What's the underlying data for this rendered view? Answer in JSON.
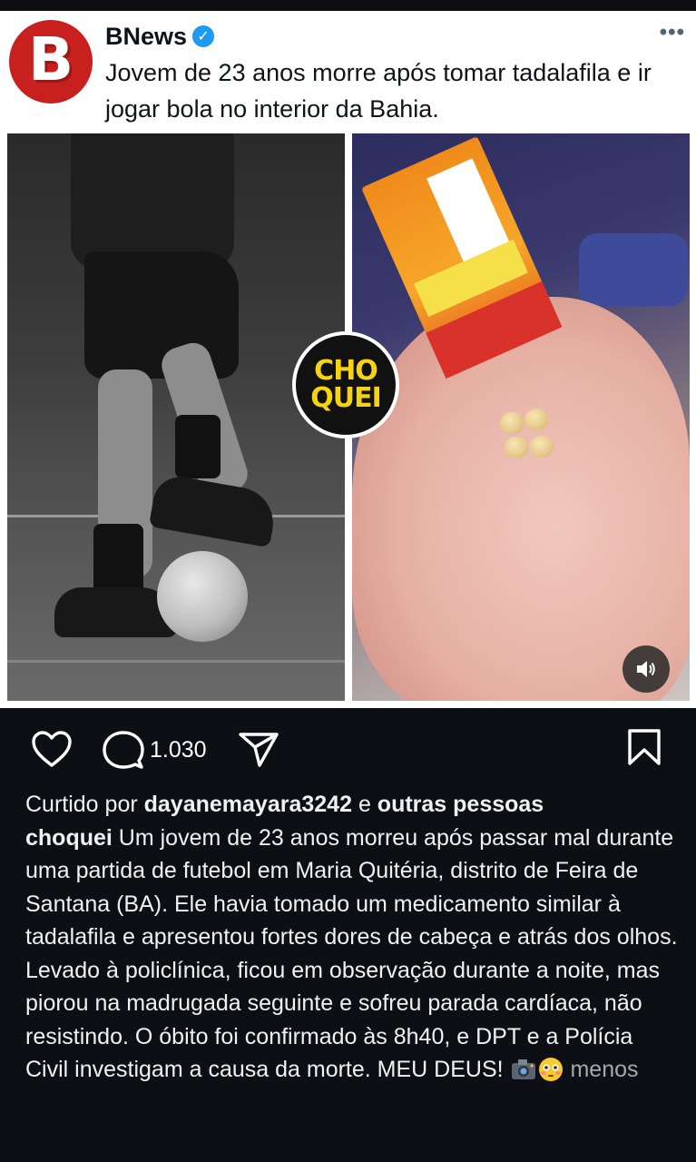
{
  "colors": {
    "app_background": "#0d0f14",
    "card_background": "#ffffff",
    "logo_red": "#c8201f",
    "verified_blue": "#1d9bf0",
    "badge_yellow": "#f5d312",
    "caption_text": "#f1f1f1",
    "muted_text": "#a8a8a8"
  },
  "embedded_post": {
    "logo_letter": "B",
    "author_name": "BNews",
    "verified_icon": "verified-check-icon",
    "more_icon": "more-dots-icon",
    "text": "Jovem de 23 anos morre após tomar tadalafila e ir jogar bola no interior da Bahia."
  },
  "image": {
    "left_description_icon": "futsal-player-photo",
    "right_description_icon": "hand-with-pills-photo",
    "badge_line1": "CHO",
    "badge_line2": "QUEI",
    "sound_icon": "speaker-icon"
  },
  "actions": {
    "like_icon": "heart-icon",
    "comment_icon": "comment-icon",
    "comment_count": "1.030",
    "share_icon": "send-icon",
    "save_icon": "bookmark-icon"
  },
  "caption": {
    "liked_prefix": "Curtido por",
    "liked_user": "dayanemayara3242",
    "liked_and": "e",
    "liked_others": "outras pessoas",
    "username": "choquei",
    "body": "Um jovem de 23 anos morreu após passar mal durante uma partida de futebol em Maria Quitéria, distrito de Feira de Santana (BA). Ele havia tomado um medicamento similar à tadalafila e apresentou fortes dores de cabeça e atrás dos olhos. Levado à policlínica, ficou em observação durante a noite, mas piorou na madrugada seguinte e sofreu parada cardíaca, não resistindo. O óbito foi confirmado às 8h40, e DPT e a Polícia Civil investigam a causa da morte. MEU DEUS!",
    "emoji_icons": [
      "camera-emoji-icon",
      "flushed-face-emoji-icon"
    ],
    "less_label": "menos"
  }
}
